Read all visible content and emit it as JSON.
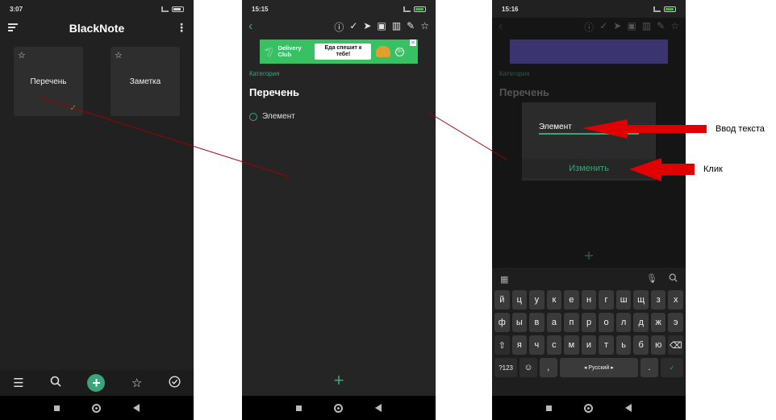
{
  "screen1": {
    "time": "3:07",
    "app_title": "BlackNote",
    "cards": [
      {
        "label": "Перечень"
      },
      {
        "label": "Заметка"
      }
    ],
    "bottom_tabs": [
      "menu-icon",
      "search-icon",
      "add-icon",
      "star-icon",
      "check-circle-icon"
    ]
  },
  "screen2": {
    "time": "15:15",
    "ad": {
      "brand": "Delivery Club",
      "slogan": "Еда спешит к тебе!",
      "age": "0+"
    },
    "category": "Категория",
    "title": "Перечень",
    "item": "Элемент"
  },
  "screen3": {
    "time": "15:16",
    "category": "Категория",
    "title": "Перечень",
    "dialog": {
      "input_value": "Элемент",
      "button_label": "Изменить"
    },
    "keyboard": {
      "row1": [
        "й",
        "ц",
        "у",
        "к",
        "е",
        "н",
        "г",
        "ш",
        "щ",
        "з",
        "х"
      ],
      "row2": [
        "ф",
        "ы",
        "в",
        "а",
        "п",
        "р",
        "о",
        "л",
        "д",
        "ж",
        "э"
      ],
      "row3": [
        "я",
        "ч",
        "с",
        "м",
        "и",
        "т",
        "ь",
        "б",
        "ю"
      ],
      "symbols_key": "?123",
      "comma_key": ",",
      "space_label": "Русский",
      "period_key": "."
    }
  },
  "annotations": {
    "input_label": "Ввод текста",
    "click_label": "Клик"
  },
  "colors": {
    "accent": "#3aa57a",
    "arrow_red": "#e00000",
    "line_red": "#a00000"
  }
}
